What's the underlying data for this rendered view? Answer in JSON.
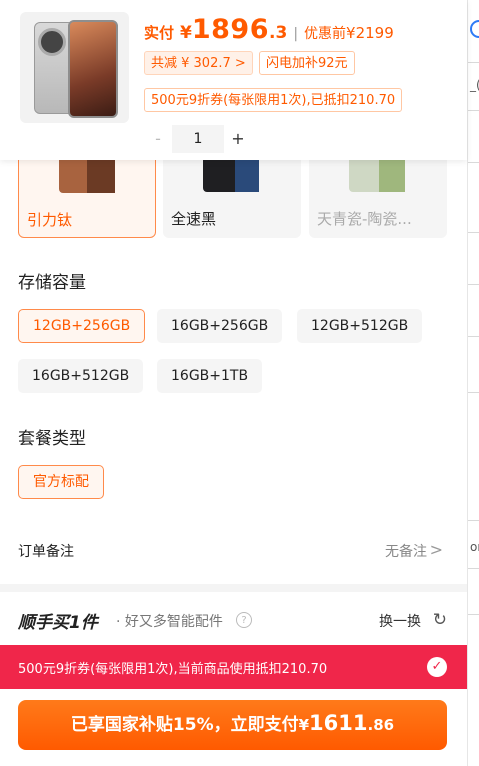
{
  "header": {
    "pay_label": "实付",
    "pay_currency": "¥",
    "pay_int": "1896",
    "pay_dec": ".3",
    "separator": "|",
    "orig_label": "优惠前",
    "orig_price": "¥2199",
    "discount_tag": "共减 ¥ 302.7 >",
    "flash_tag": "闪电加补92元",
    "coupon_tag": "500元9折券(每张限用1次),已抵扣210.70",
    "qty_minus": "-",
    "quantity": "1",
    "qty_plus": "+"
  },
  "colors": {
    "options": [
      {
        "label": "引力钛"
      },
      {
        "label": "全速黑"
      },
      {
        "label": "天青瓷-陶瓷..."
      }
    ],
    "selected_index": 0
  },
  "storage": {
    "title": "存储容量",
    "options": [
      {
        "label": "12GB+256GB"
      },
      {
        "label": "16GB+256GB"
      },
      {
        "label": "12GB+512GB"
      },
      {
        "label": "16GB+512GB"
      },
      {
        "label": "16GB+1TB"
      }
    ],
    "selected_index": 0
  },
  "bundle": {
    "title": "套餐类型",
    "options": [
      {
        "label": "官方标配"
      }
    ],
    "selected_index": 0
  },
  "order_note": {
    "label": "订单备注",
    "value": "无备注",
    "chevron": ">"
  },
  "addons": {
    "brand": "顺手买1件",
    "subtitle": "· 好又多智能配件",
    "help": "?",
    "refresh_label": "换一换",
    "refresh_icon": "↻"
  },
  "coupon_banner": {
    "text": "500元9折券(每张限用1次),当前商品使用抵扣210.70",
    "check": "✓"
  },
  "pay_button": {
    "prefix": "已享国家补贴15%，立即支付",
    "currency": "¥",
    "amount_int": "1611",
    "amount_dec": ".86"
  },
  "right_strip": {
    "text1": "_(",
    "text2": "on"
  },
  "colors_theme": {
    "accent": "#ff5a00",
    "banner": "#f0264a",
    "chip_bg": "#f5f5f5"
  }
}
